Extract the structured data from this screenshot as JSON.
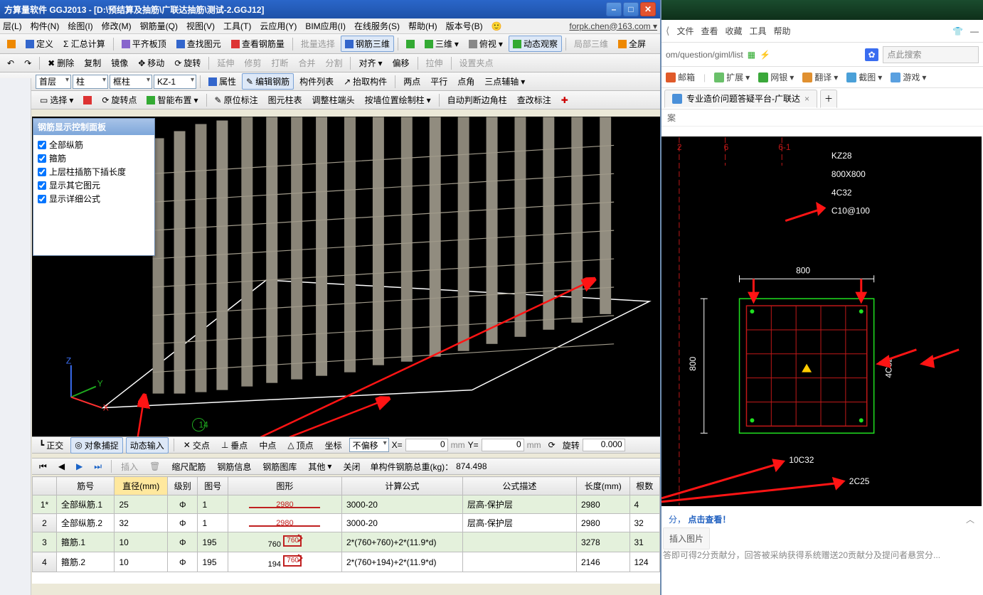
{
  "app": {
    "title": "方算量软件 GGJ2013 - [D:\\预结算及抽筋\\广联达抽筋\\测试-2.GGJ12]",
    "email": "forpk.chen@163.com ▾"
  },
  "menu": [
    "层(L)",
    "构件(N)",
    "绘图(I)",
    "修改(M)",
    "钢筋量(Q)",
    "视图(V)",
    "工具(T)",
    "云应用(Y)",
    "BIM应用(I)",
    "在线服务(S)",
    "帮助(H)",
    "版本号(B)"
  ],
  "tbar1": {
    "define": "定义",
    "sum": "Σ 汇总计算",
    "pingqi": "平齐板顶",
    "find": "查找图元",
    "view_rebar": "查看钢筋量",
    "batch": "批量选择",
    "rebar3d": "钢筋三维",
    "sanwei": "三维",
    "fushi": "俯视",
    "dynview": "动态观察",
    "jubu": "局部三维",
    "fullscreen": "全屏"
  },
  "tbar2": {
    "del": "删除",
    "copy": "复制",
    "mirror": "镜像",
    "move": "移动",
    "rotate": "旋转",
    "extend": "延伸",
    "trim": "修剪",
    "break": "打断",
    "merge": "合并",
    "split": "分割",
    "align": "对齐",
    "offset": "偏移",
    "stretch": "拉伸",
    "set_grip": "设置夹点"
  },
  "tbar3": {
    "floor": "首层",
    "cat": "柱",
    "type": "框柱",
    "id": "KZ-1",
    "attr": "属性",
    "edit_rebar": "编辑钢筋",
    "comp_list": "构件列表",
    "extract": "抬取构件",
    "twopt": "两点",
    "parallel": "平行",
    "angle": "点角",
    "three_aux": "三点辅轴"
  },
  "tbar4": {
    "select": "选择",
    "rotate_pt": "旋转点",
    "smart": "智能布置",
    "orig_label": "原位标注",
    "tuyi": "图元柱表",
    "adjust": "调整柱端头",
    "draw_by_wall": "按墙位置绘制柱",
    "auto_corner": "自动判断边角柱",
    "review_label": "查改标注"
  },
  "float_panel": {
    "title": "钢筋显示控制面板",
    "items": [
      "全部纵筋",
      "箍筋",
      "上层柱插筋下插长度",
      "显示其它图元",
      "显示详细公式"
    ]
  },
  "bottom1": {
    "orth": "正交",
    "snap": "对象捕捉",
    "dyn": "动态输入",
    "jiaodian": "交点",
    "chuidian": "垂点",
    "zhongdian": "中点",
    "dingdian": "顶点",
    "coord": "坐标",
    "no_offset": "不偏移",
    "x_lbl": "X=",
    "x_val": "0",
    "x_unit": "mm",
    "y_lbl": "Y=",
    "y_val": "0",
    "y_unit": "mm",
    "rot_lbl": "旋转",
    "rot_val": "0.000"
  },
  "bottom2": {
    "insert": "插入",
    "scale_rebar": "缩尺配筋",
    "rebar_info": "钢筋信息",
    "rebar_lib": "钢筋图库",
    "other": "其他",
    "close": "关闭",
    "total_label": "单构件钢筋总重(kg)：",
    "total_value": "874.498"
  },
  "rebar_table": {
    "headers": [
      "",
      "筋号",
      "直径(mm)",
      "级别",
      "图号",
      "图形",
      "计算公式",
      "公式描述",
      "长度(mm)",
      "根数"
    ],
    "rows": [
      {
        "n": "1*",
        "name": "全部纵筋.1",
        "dia": "25",
        "grade": "Φ",
        "fig": "1",
        "shape": "2980",
        "formula": "3000-20",
        "desc": "层高-保护层",
        "len": "2980",
        "cnt": "4",
        "sel": true
      },
      {
        "n": "2",
        "name": "全部纵筋.2",
        "dia": "32",
        "grade": "Φ",
        "fig": "1",
        "shape": "2980",
        "formula": "3000-20",
        "desc": "层高-保护层",
        "len": "2980",
        "cnt": "32",
        "sel": false
      },
      {
        "n": "3",
        "name": "箍筋.1",
        "dia": "10",
        "grade": "Φ",
        "fig": "195",
        "shape": "760 [760]",
        "formula": "2*(760+760)+2*(11.9*d)",
        "desc": "",
        "len": "3278",
        "cnt": "31",
        "sel": true
      },
      {
        "n": "4",
        "name": "箍筋.2",
        "dia": "10",
        "grade": "Φ",
        "fig": "195",
        "shape": "194 [760]",
        "formula": "2*(760+194)+2*(11.9*d)",
        "desc": "",
        "len": "2146",
        "cnt": "124",
        "sel": false
      }
    ]
  },
  "browser": {
    "top_menu": [
      "文件",
      "查看",
      "收藏",
      "工具",
      "帮助"
    ],
    "url_fragment": "om/question/giml/list",
    "search_placeholder": "点此搜索",
    "ext": [
      {
        "label": "邮箱",
        "color": "#e05a2a"
      },
      {
        "label": "扩展",
        "color": "#6ac06a"
      },
      {
        "label": "网银",
        "color": "#3aa83a"
      },
      {
        "label": "翻译",
        "color": "#e09030"
      },
      {
        "label": "截图",
        "color": "#4aa0d8"
      },
      {
        "label": "游戏",
        "color": "#5aa0e0"
      }
    ],
    "tab_title": "专业造价问题答疑平台-广联达",
    "sub_tab": "案"
  },
  "cad": {
    "col_label": "KZ28",
    "size": "800X800",
    "main": "4C32",
    "stirrup": "C10@100",
    "dim_top": "800",
    "dim_left": "800",
    "right_label": "4C32",
    "bottom_label": "10C32",
    "extra_label": "2C25",
    "axis_left": "2",
    "axis_right": "6",
    "axis_right2": "6-1"
  },
  "cad_footer": {
    "fen": "分，",
    "link": "点击查看！",
    "insert_img": "插入图片",
    "tip": "答即可得2分贡献分，回答被采纳获得系统赠送20贡献分及提问者悬赏分..."
  }
}
